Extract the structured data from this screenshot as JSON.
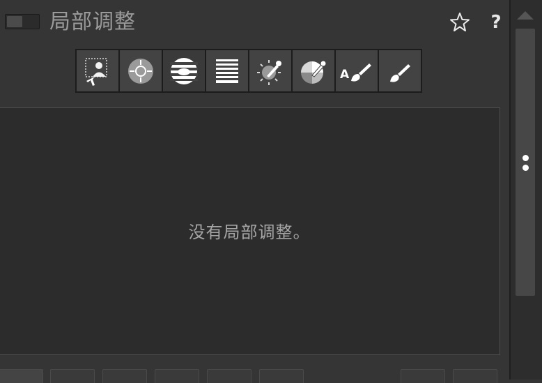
{
  "header": {
    "title": "局部调整",
    "toggle_state": "off",
    "favorite_icon": "star-outline-icon",
    "help_label": "?"
  },
  "toolbar": {
    "tools": [
      {
        "name": "subject-select-tool",
        "icon": "person-select-icon"
      },
      {
        "name": "radial-point-tool",
        "icon": "crosshair-circle-icon"
      },
      {
        "name": "radial-gradient-tool",
        "icon": "radial-gradient-icon"
      },
      {
        "name": "linear-gradient-tool",
        "icon": "linear-gradient-icon"
      },
      {
        "name": "luminance-picker-tool",
        "icon": "luminance-eyedropper-icon"
      },
      {
        "name": "color-picker-tool",
        "icon": "color-eyedropper-icon"
      },
      {
        "name": "auto-brush-tool",
        "icon": "auto-brush-icon",
        "label": "A"
      },
      {
        "name": "brush-tool",
        "icon": "brush-icon"
      }
    ],
    "active_index": 2
  },
  "content": {
    "empty_message": "没有局部调整。"
  },
  "colors": {
    "panel_bg": "#353535",
    "content_bg": "#2c2c2c",
    "tool_bg": "#434343",
    "text": "#a5a5a5"
  }
}
